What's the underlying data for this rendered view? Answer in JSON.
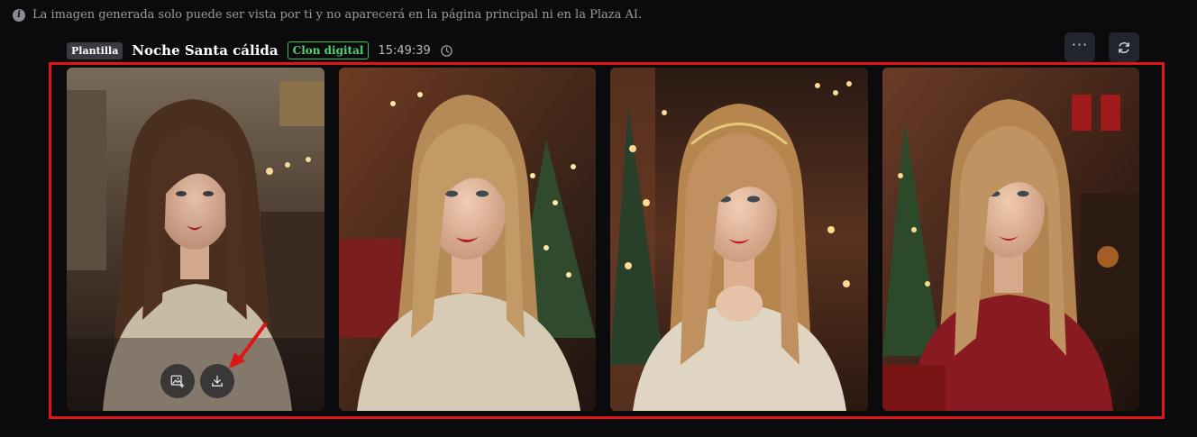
{
  "notice": {
    "text": "La imagen generada solo puede ser vista por ti y no aparecerá en la página principal ni en la Plaza AI.",
    "icon": "info-icon"
  },
  "task": {
    "template_tag": "Plantilla",
    "title": "Noche Santa cálida",
    "mode_tag": "Clon digital",
    "time": "15:49:39",
    "history_icon": "history-clock-icon"
  },
  "actions": {
    "more_icon": "more-dots-icon",
    "more_label": "···",
    "refresh_icon": "refresh-icon"
  },
  "images": [
    {
      "name": "generated-image-1",
      "hover_actions": [
        "edit-image-icon",
        "download-icon"
      ]
    },
    {
      "name": "generated-image-2"
    },
    {
      "name": "generated-image-3"
    },
    {
      "name": "generated-image-4"
    }
  ],
  "annotations": {
    "highlight_color": "#e01515",
    "arrow_color": "#e01515"
  },
  "colors": {
    "background": "#0b0b0e",
    "clone_tag": "#4fd36f",
    "template_tag_bg": "#3a3a42"
  }
}
